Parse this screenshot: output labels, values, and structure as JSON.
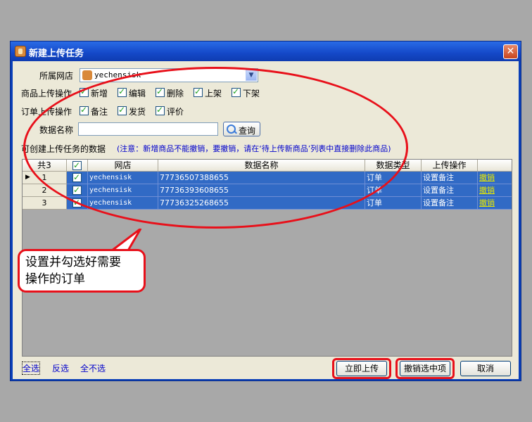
{
  "window": {
    "title": "新建上传任务",
    "close_symbol": "✕"
  },
  "form": {
    "store_label": "所属网店",
    "store_value": "yechensisk",
    "product_ops_label": "商品上传操作",
    "product_ops": [
      {
        "label": "新增",
        "checked": true
      },
      {
        "label": "编辑",
        "checked": true
      },
      {
        "label": "删除",
        "checked": true
      },
      {
        "label": "上架",
        "checked": true
      },
      {
        "label": "下架",
        "checked": true
      }
    ],
    "order_ops_label": "订单上传操作",
    "order_ops": [
      {
        "label": "备注",
        "checked": true
      },
      {
        "label": "发货",
        "checked": true
      },
      {
        "label": "评价",
        "checked": true
      }
    ],
    "name_label": "数据名称",
    "name_value": "",
    "query_button": "查询"
  },
  "grid_title": "可创建上传任务的数据",
  "note": "(注意：新增商品不能撤销，要撤销，请在‘待上传新商品’列表中直接删除此商品)",
  "grid": {
    "headers": {
      "count": "共3",
      "store": "网店",
      "name": "数据名称",
      "type": "数据类型",
      "op": "上传操作"
    },
    "rows": [
      {
        "index": "1",
        "store": "yechensisk",
        "name": "77736507388655",
        "type": "订单",
        "op": "设置备注",
        "action": "撤销",
        "checked": true
      },
      {
        "index": "2",
        "store": "yechensisk",
        "name": "77736393608655",
        "type": "订单",
        "op": "设置备注",
        "action": "撤销",
        "checked": true
      },
      {
        "index": "3",
        "store": "yechensisk",
        "name": "77736325268655",
        "type": "订单",
        "op": "设置备注",
        "action": "撤销",
        "checked": true
      }
    ]
  },
  "callout": {
    "line1": "设置并勾选好需要",
    "line2": "操作的订单"
  },
  "footer": {
    "select_all": "全选",
    "invert": "反选",
    "select_none": "全不选",
    "upload_now": "立即上传",
    "cancel_selected": "撤销选中项",
    "cancel": "取消"
  },
  "colors": {
    "highlight": "#e8101a",
    "selection": "#316ac5",
    "titlebar": "#1448c8"
  }
}
